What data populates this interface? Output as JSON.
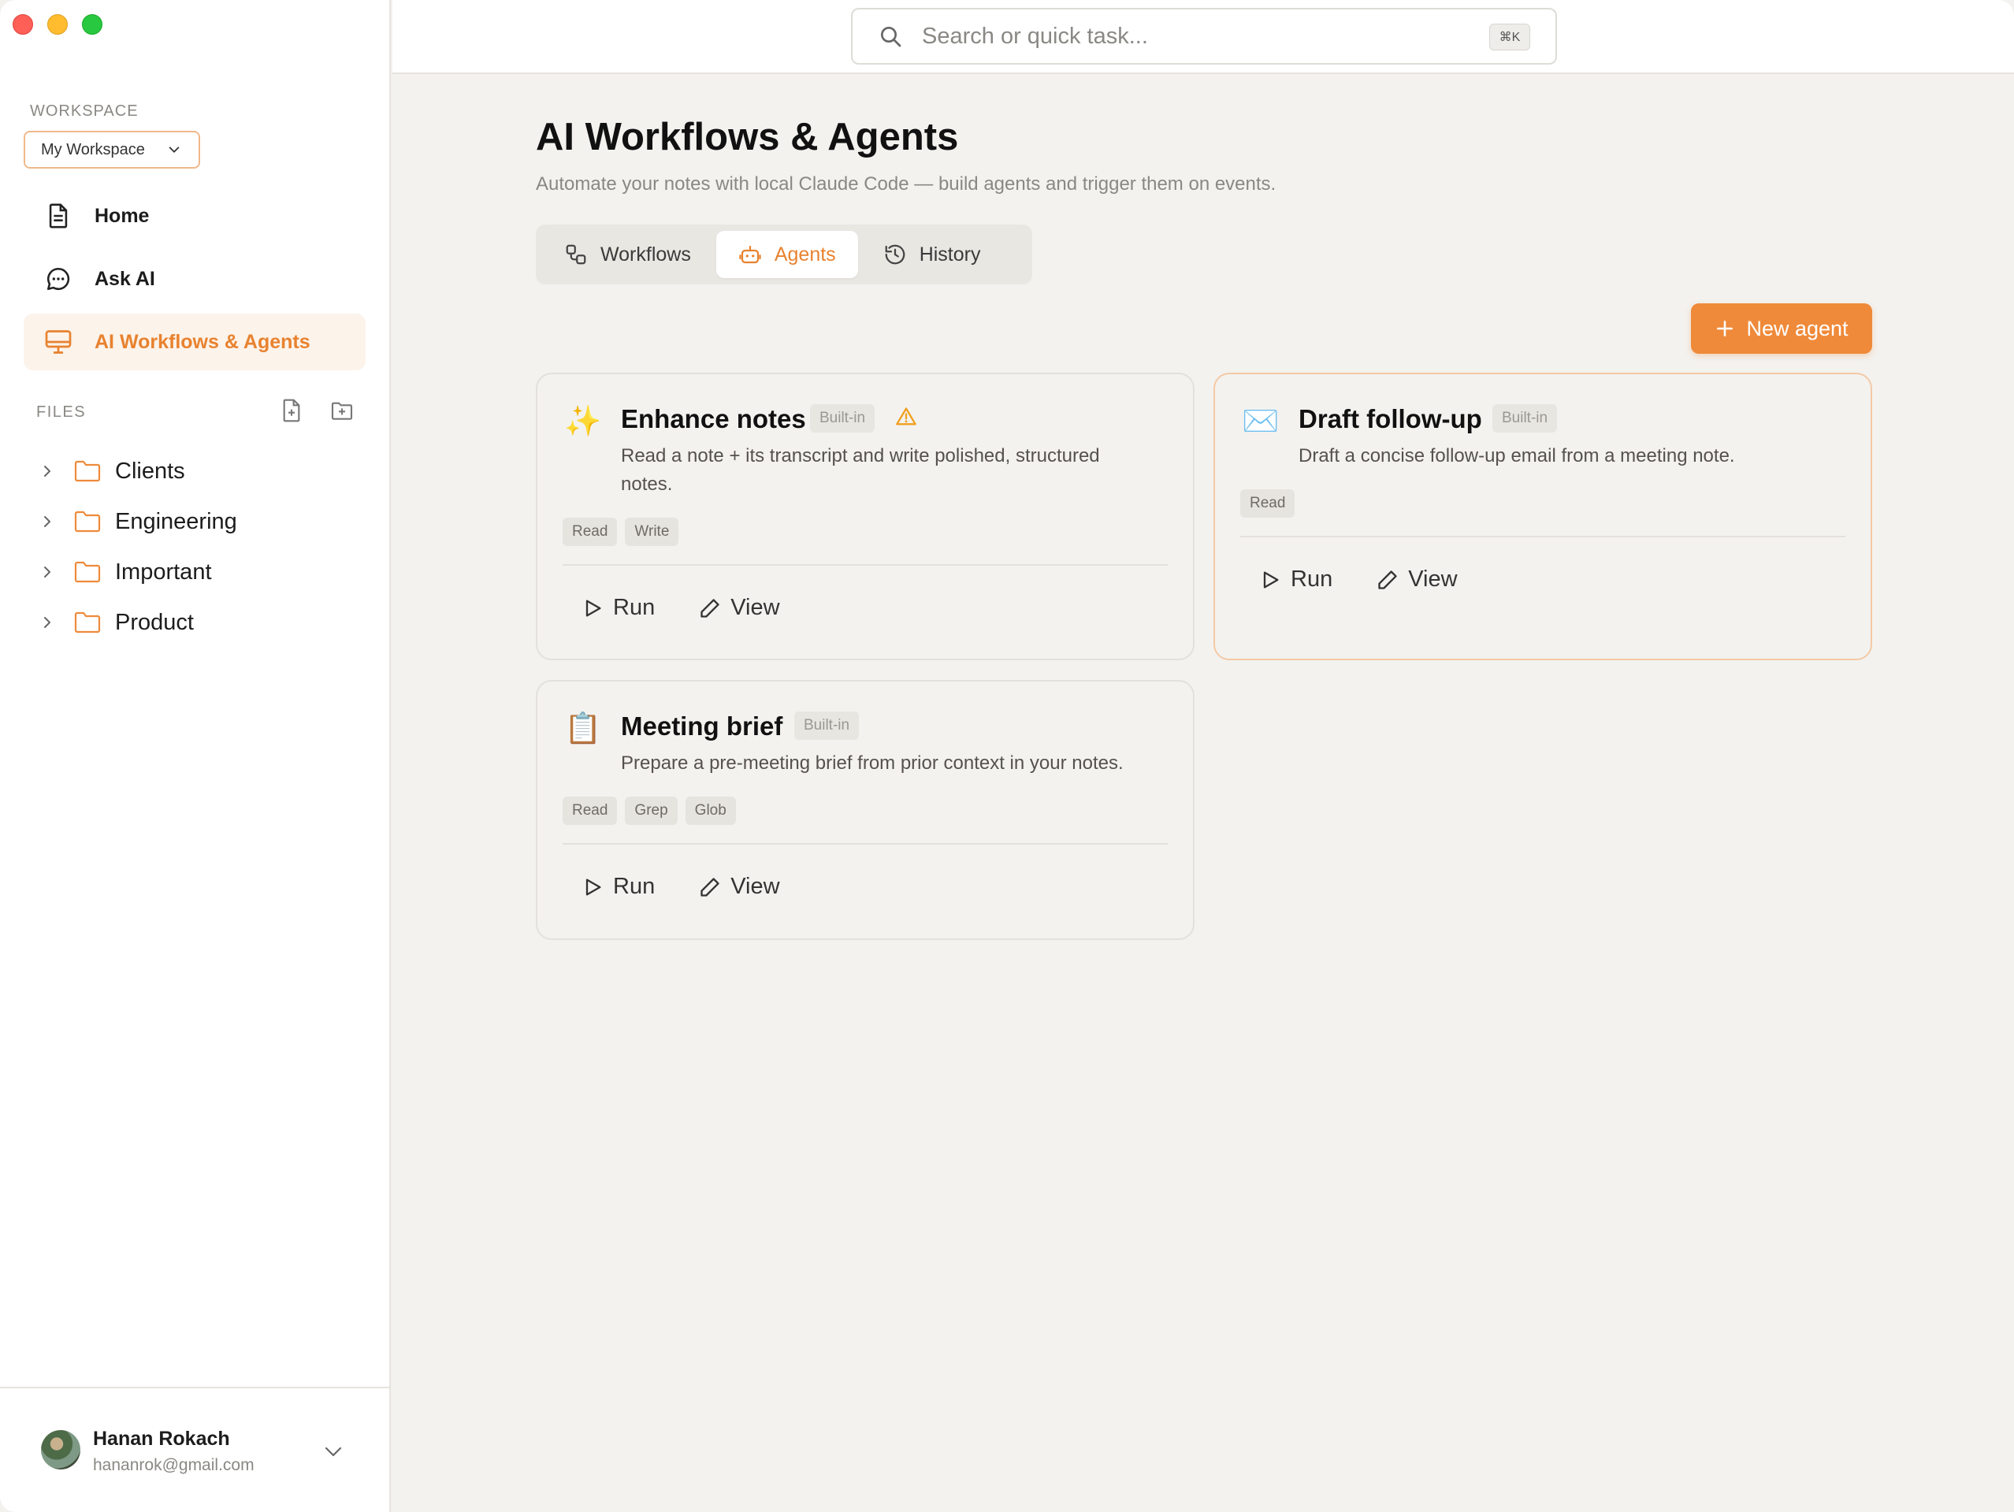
{
  "sidebar": {
    "workspace_label": "WORKSPACE",
    "workspace_name": "My Workspace",
    "nav": [
      {
        "label": "Home",
        "icon": "document-icon"
      },
      {
        "label": "Ask AI",
        "icon": "chat-icon"
      },
      {
        "label": "AI Workflows & Agents",
        "icon": "monitor-icon",
        "active": true
      }
    ],
    "files_label": "FILES",
    "folders": [
      {
        "label": "Clients"
      },
      {
        "label": "Engineering"
      },
      {
        "label": "Important"
      },
      {
        "label": "Product"
      }
    ],
    "user": {
      "name": "Hanan Rokach",
      "email": "hananrok@gmail.com"
    }
  },
  "topbar": {
    "search_placeholder": "Search or quick task...",
    "shortcut": "⌘K"
  },
  "main": {
    "title": "AI Workflows & Agents",
    "subtitle": "Automate your notes with local Claude Code — build agents and trigger them on events.",
    "tabs": [
      {
        "label": "Workflows",
        "icon": "workflow-icon"
      },
      {
        "label": "Agents",
        "icon": "bot-icon",
        "active": true
      },
      {
        "label": "History",
        "icon": "history-icon"
      }
    ],
    "new_agent_label": "New agent",
    "agents": [
      {
        "emoji": "✨",
        "title": "Enhance notes",
        "badge": "Built-in",
        "warning": true,
        "desc_line1": "Read a note + its transcript and write polished, structured",
        "desc_line2": "notes.",
        "tags": [
          "Read",
          "Write"
        ],
        "run_label": "Run",
        "view_label": "View"
      },
      {
        "emoji": "✉️",
        "title": "Draft follow-up",
        "badge": "Built-in",
        "warning": false,
        "desc_line1": "Draft a concise follow-up email from a meeting note.",
        "desc_line2": "",
        "tags": [
          "Read"
        ],
        "run_label": "Run",
        "view_label": "View"
      },
      {
        "emoji": "📋",
        "title": "Meeting brief",
        "badge": "Built-in",
        "warning": false,
        "desc_line1": "Prepare a pre-meeting brief from prior context in your notes.",
        "desc_line2": "",
        "tags": [
          "Read",
          "Grep",
          "Glob"
        ],
        "run_label": "Run",
        "view_label": "View"
      }
    ]
  },
  "colors": {
    "accent": "#e8822f",
    "button": "#ef8a3a",
    "background": "#f3f2ef"
  }
}
